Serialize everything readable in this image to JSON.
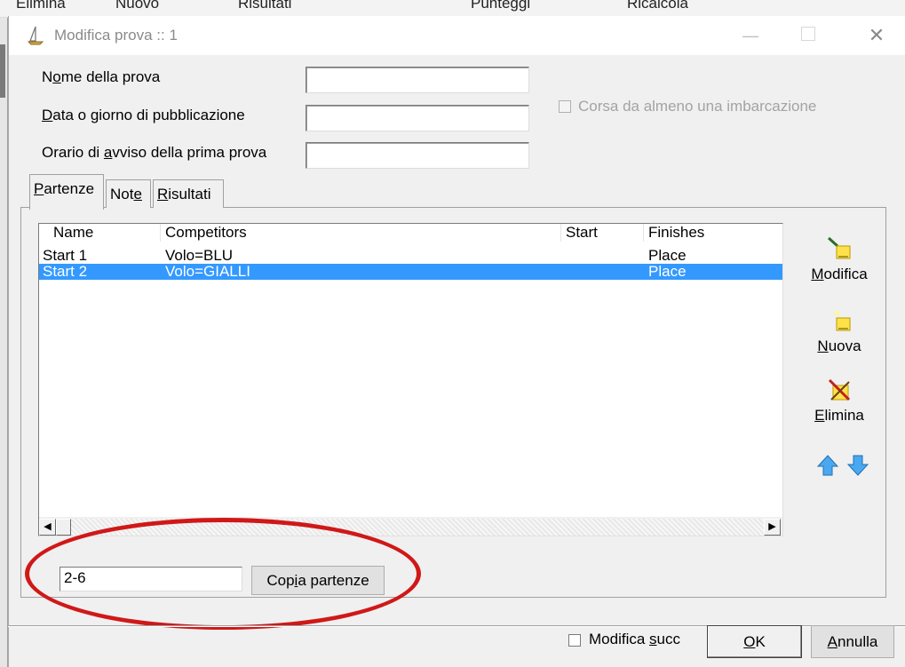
{
  "background": {
    "toolbar_items": [
      "Elimina",
      "Nuovo",
      "Risultati",
      "Punteggi",
      "Ricalcola"
    ]
  },
  "dialog": {
    "title": "Modifica prova :: 1",
    "window_buttons": {
      "minimize": "—",
      "close": "✕"
    }
  },
  "form": {
    "name_label_pre": "N",
    "name_label_ul": "o",
    "name_label_post": "me della prova",
    "name_value": "",
    "date_label_pre": "",
    "date_label_ul": "D",
    "date_label_post": "ata o giorno di pubblicazione",
    "date_value": "",
    "time_label_pre": "Orario di ",
    "time_label_ul": "a",
    "time_label_post": "vviso della prima prova",
    "time_value": "",
    "checkbox_label": "Corsa da almeno una imbarcazione",
    "checkbox_checked": false
  },
  "tabs": [
    {
      "pre": "",
      "ul": "P",
      "post": "artenze"
    },
    {
      "pre": "Not",
      "ul": "e",
      "post": ""
    },
    {
      "pre": "",
      "ul": "R",
      "post": "isultati"
    }
  ],
  "list": {
    "columns": [
      "Name",
      "Competitors",
      "Start",
      "Finishes"
    ],
    "rows": [
      {
        "name": "Start 1",
        "competitors": "Volo=BLU",
        "start": "",
        "finishes": "Place",
        "selected": false
      },
      {
        "name": "Start 2",
        "competitors": "Volo=GIALLI",
        "start": "",
        "finishes": "Place",
        "selected": true
      }
    ]
  },
  "side_buttons": {
    "modify": {
      "ul": "M",
      "post": "odifica"
    },
    "new": {
      "ul": "N",
      "post": "uova"
    },
    "delete": {
      "ul": "E",
      "post": "limina"
    }
  },
  "copy": {
    "input_value": "2-6",
    "button_pre": "Cop",
    "button_ul": "i",
    "button_post": "a partenze"
  },
  "footer": {
    "checkbox_label_pre": "Modifica ",
    "checkbox_label_ul": "s",
    "checkbox_label_post": "ucc",
    "checkbox_checked": false,
    "ok_ul": "O",
    "ok_post": "K",
    "cancel_ul": "A",
    "cancel_post": "nnulla"
  },
  "colors": {
    "selection": "#3399ff",
    "annotation": "#d01818"
  }
}
